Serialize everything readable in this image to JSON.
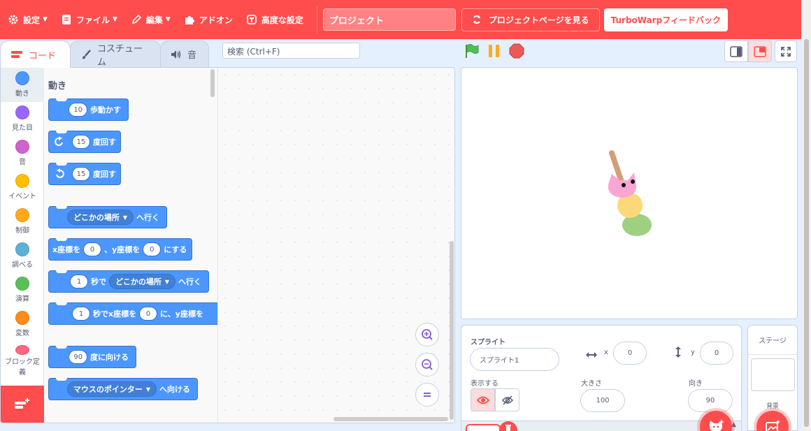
{
  "menu": {
    "settings": "設定",
    "file": "ファイル",
    "edit": "編集",
    "addons": "アドオン",
    "advanced": "高度な設定",
    "project_title": "プロジェクト",
    "see_project_page": "プロジェクトページを見る",
    "feedback": "TurboWarpフィードバック"
  },
  "tabs": [
    {
      "label": "コード",
      "icon": "code-icon"
    },
    {
      "label": "コスチューム",
      "icon": "brush-icon"
    },
    {
      "label": "音",
      "icon": "speaker-icon"
    }
  ],
  "search": {
    "placeholder": "検索 (Ctrl+F)"
  },
  "categories": [
    {
      "label": "動き",
      "color": "#4c97ff"
    },
    {
      "label": "見た目",
      "color": "#9966ff"
    },
    {
      "label": "音",
      "color": "#cf63cf"
    },
    {
      "label": "イベント",
      "color": "#ffbf00"
    },
    {
      "label": "制御",
      "color": "#ffab19"
    },
    {
      "label": "調べる",
      "color": "#5cb1d6"
    },
    {
      "label": "演算",
      "color": "#59c059"
    },
    {
      "label": "変数",
      "color": "#ff8c1a"
    },
    {
      "label": "ブロック定義",
      "color": "#ff6680"
    }
  ],
  "palette": {
    "section_title": "動き",
    "move": {
      "value": "10",
      "text": "歩動かす"
    },
    "turn_right": {
      "value": "15",
      "text": "度回す"
    },
    "turn_left": {
      "value": "15",
      "text": "度回す"
    },
    "goto": {
      "menu": "どこかの場所",
      "text": "へ行く"
    },
    "goto_xy": {
      "pre": "x座標を",
      "x": "0",
      "mid": "、y座標を",
      "y": "0",
      "post": "にする"
    },
    "glide": {
      "secs": "1",
      "t1": "秒で",
      "menu": "どこかの場所",
      "t2": "へ行く"
    },
    "glide_xy": {
      "secs": "1",
      "t1": "秒でx座標を",
      "x": "0",
      "t2": "に、y座標を"
    },
    "point": {
      "value": "90",
      "text": "度に向ける"
    },
    "point_towards": {
      "menu": "マウスのポインター",
      "text": "へ向ける"
    }
  },
  "sprite_info": {
    "sprite_label": "スプライト",
    "sprite_name": "スプライト1",
    "x_label": "x",
    "x_value": "0",
    "y_label": "y",
    "y_value": "0",
    "show_label": "表示する",
    "size_label": "大きさ",
    "size_value": "100",
    "direction_label": "向き",
    "direction_value": "90"
  },
  "stage_panel": {
    "title": "ステージ",
    "backdrop_label": "背景"
  }
}
